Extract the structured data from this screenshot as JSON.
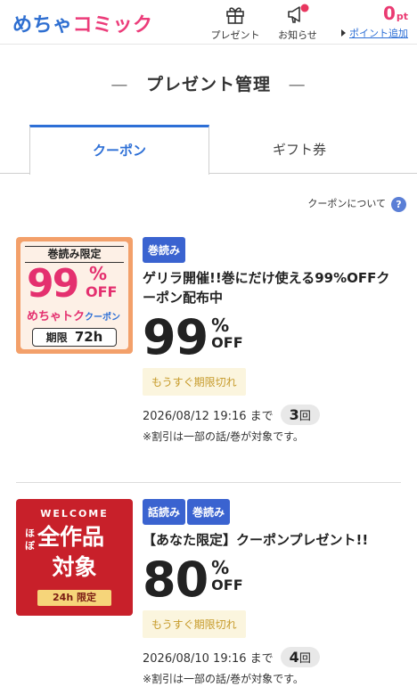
{
  "header": {
    "logo_part1": "めちゃ",
    "logo_part2": "コミック",
    "present_label": "プレゼント",
    "notice_label": "お知らせ",
    "points_value": "0",
    "points_unit": "pt",
    "points_add_label": "ポイント追加",
    "notice_dot_color": "#e8365f"
  },
  "page": {
    "title": "プレゼント管理",
    "title_dash": "—"
  },
  "tabs": [
    {
      "label": "クーポン",
      "active": true
    },
    {
      "label": "ギフト券",
      "active": false
    }
  ],
  "about_link": "クーポンについて",
  "about_icon": "?",
  "coupons": [
    {
      "thumb": {
        "top_text": "巻読み限定",
        "big": "99",
        "pct": "%",
        "off": "OFF",
        "brand": "めちゃトク",
        "brand_suffix": "クーポン",
        "limit_label": "期限",
        "limit_value": "72h"
      },
      "badges": [
        "巻読み"
      ],
      "title": "ゲリラ開催!!巻にだけ使える99%OFFクーポン配布中",
      "discount": "99",
      "pct": "%",
      "off": "OFF",
      "expiry_tag": "もうすぐ期限切れ",
      "deadline": "2026/08/12 19:16 まで",
      "count_num": "3",
      "count_unit": "回",
      "note": "※割引は一部の話/巻が対象です。"
    },
    {
      "thumb": {
        "top_text": "WELCOME",
        "side_text": "ほぼ",
        "line1": "全作品",
        "line2": "対象",
        "limit": "24h 限定"
      },
      "badges": [
        "話読み",
        "巻読み"
      ],
      "title": "【あなた限定】クーポンプレゼント!!",
      "discount": "80",
      "pct": "%",
      "off": "OFF",
      "expiry_tag": "もうすぐ期限切れ",
      "deadline": "2026/08/10 19:16 まで",
      "count_num": "4",
      "count_unit": "回",
      "note": "※割引は一部の話/巻が対象です。"
    }
  ]
}
